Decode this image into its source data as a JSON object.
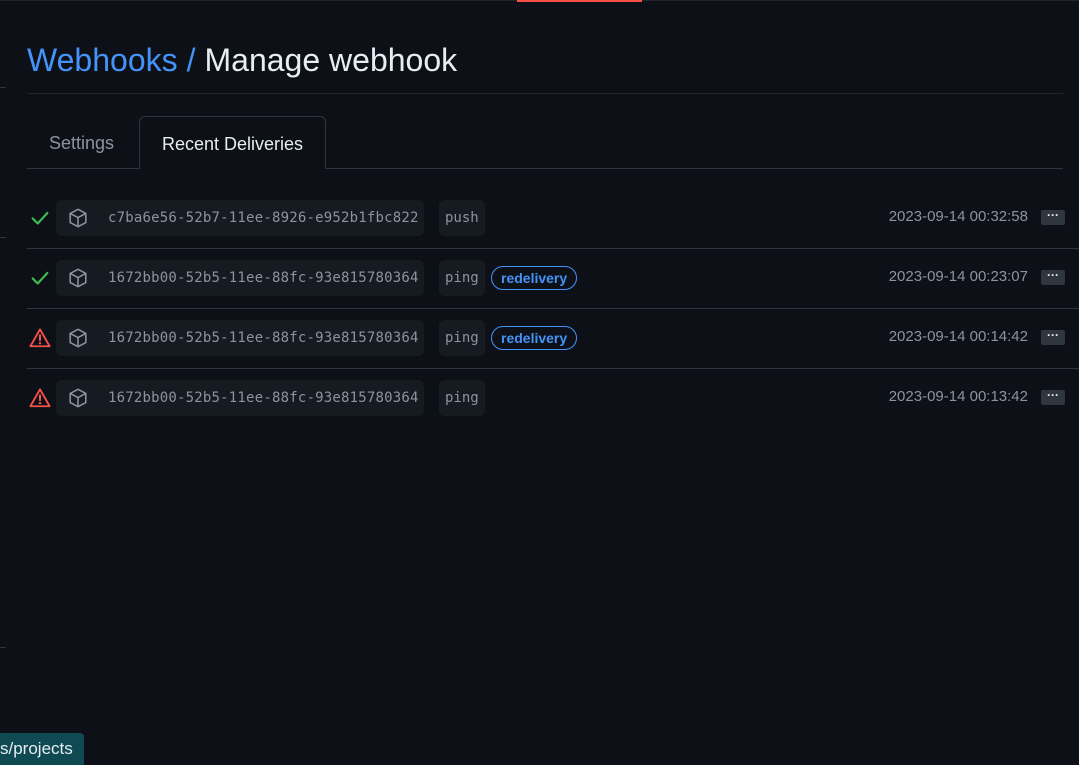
{
  "header": {
    "breadcrumb_link": "Webhooks",
    "breadcrumb_separator": "/",
    "title": "Manage webhook"
  },
  "tabs": [
    {
      "label": "Settings",
      "active": false
    },
    {
      "label": "Recent Deliveries",
      "active": true
    }
  ],
  "deliveries": [
    {
      "status": "success",
      "status_icon": "check-icon",
      "guid": "c7ba6e56-52b7-11ee-8926-e952b1fbc822",
      "event": "push",
      "redelivery": "",
      "time": "2023-09-14 00:32:58"
    },
    {
      "status": "success",
      "status_icon": "check-icon",
      "guid": "1672bb00-52b5-11ee-88fc-93e815780364",
      "event": "ping",
      "redelivery": "redelivery",
      "time": "2023-09-14 00:23:07"
    },
    {
      "status": "failed",
      "status_icon": "alert-icon",
      "guid": "1672bb00-52b5-11ee-88fc-93e815780364",
      "event": "ping",
      "redelivery": "redelivery",
      "time": "2023-09-14 00:14:42"
    },
    {
      "status": "failed",
      "status_icon": "alert-icon",
      "guid": "1672bb00-52b5-11ee-88fc-93e815780364",
      "event": "ping",
      "redelivery": "",
      "time": "2023-09-14 00:13:42"
    }
  ],
  "more_button_label": "···",
  "status_bar_url": "s/projects",
  "colors": {
    "background": "#0d1117",
    "link": "#4493f8",
    "success": "#3fb950",
    "danger": "#f85149",
    "muted": "#8b949e"
  }
}
